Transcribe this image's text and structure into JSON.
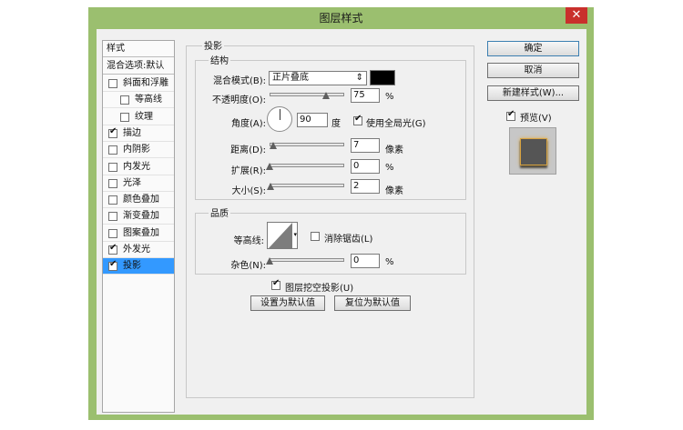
{
  "window": {
    "title": "图层样式",
    "close": "✕"
  },
  "style_list": {
    "header": "样式",
    "blend_options": "混合选项:默认",
    "items": [
      {
        "label": "斜面和浮雕",
        "checked": false,
        "indent": false
      },
      {
        "label": "等高线",
        "checked": false,
        "indent": true
      },
      {
        "label": "纹理",
        "checked": false,
        "indent": true
      },
      {
        "label": "描边",
        "checked": true,
        "indent": false
      },
      {
        "label": "内阴影",
        "checked": false,
        "indent": false
      },
      {
        "label": "内发光",
        "checked": false,
        "indent": false
      },
      {
        "label": "光泽",
        "checked": false,
        "indent": false
      },
      {
        "label": "颜色叠加",
        "checked": false,
        "indent": false
      },
      {
        "label": "渐变叠加",
        "checked": false,
        "indent": false
      },
      {
        "label": "图案叠加",
        "checked": false,
        "indent": false
      },
      {
        "label": "外发光",
        "checked": true,
        "indent": false
      },
      {
        "label": "投影",
        "checked": true,
        "indent": false,
        "selected": true
      }
    ]
  },
  "panel": {
    "title": "投影",
    "structure": {
      "title": "结构",
      "blend_mode_label": "混合模式(B):",
      "blend_mode_value": "正片叠底",
      "blend_color": "#000000",
      "opacity_label": "不透明度(O):",
      "opacity_value": "75",
      "opacity_unit": "%",
      "angle_label": "角度(A):",
      "angle_value": "90",
      "angle_unit": "度",
      "global_light_label": "使用全局光(G)",
      "global_light_checked": true,
      "distance_label": "距离(D):",
      "distance_value": "7",
      "distance_unit": "像素",
      "spread_label": "扩展(R):",
      "spread_value": "0",
      "spread_unit": "%",
      "size_label": "大小(S):",
      "size_value": "2",
      "size_unit": "像素"
    },
    "quality": {
      "title": "品质",
      "contour_label": "等高线:",
      "anti_alias_label": "消除锯齿(L)",
      "anti_alias_checked": false,
      "noise_label": "杂色(N):",
      "noise_value": "0",
      "noise_unit": "%"
    },
    "knockout_label": "图层挖空投影(U)",
    "knockout_checked": true,
    "make_default": "设置为默认值",
    "reset_default": "复位为默认值"
  },
  "buttons": {
    "ok": "确定",
    "cancel": "取消",
    "new_style": "新建样式(W)...",
    "preview_label": "预览(V)",
    "preview_checked": true
  },
  "colors": {
    "titlebar": "#9bbf6f",
    "selection": "#3399ff",
    "close": "#c9302c"
  }
}
